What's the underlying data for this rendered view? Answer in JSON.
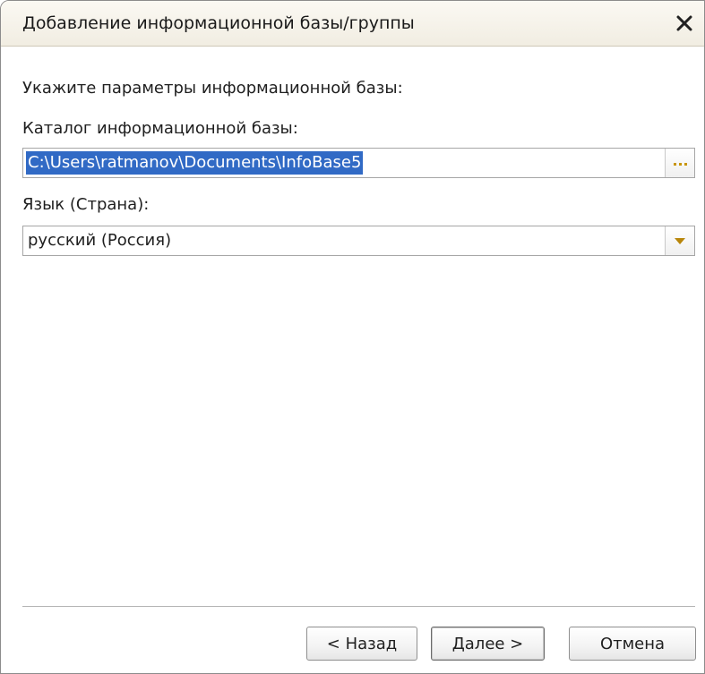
{
  "window": {
    "title": "Добавление информационной базы/группы",
    "close_icon": "close-icon"
  },
  "form": {
    "instruction": "Укажите параметры информационной базы:",
    "catalog_label": "Каталог информационной базы:",
    "catalog_value": "C:\\Users\\ratmanov\\Documents\\InfoBase5",
    "browse_icon": "ellipsis-icon",
    "language_label": "Язык (Страна):",
    "language_value": "русский (Россия)",
    "dropdown_icon": "dropdown-arrow-icon"
  },
  "buttons": {
    "back": "< Назад",
    "next": "Далее >",
    "cancel": "Отмена"
  },
  "colors": {
    "selection": "#316ac5",
    "dropdown_arrow": "#b8860b",
    "browse_dots": "#c8960c"
  }
}
